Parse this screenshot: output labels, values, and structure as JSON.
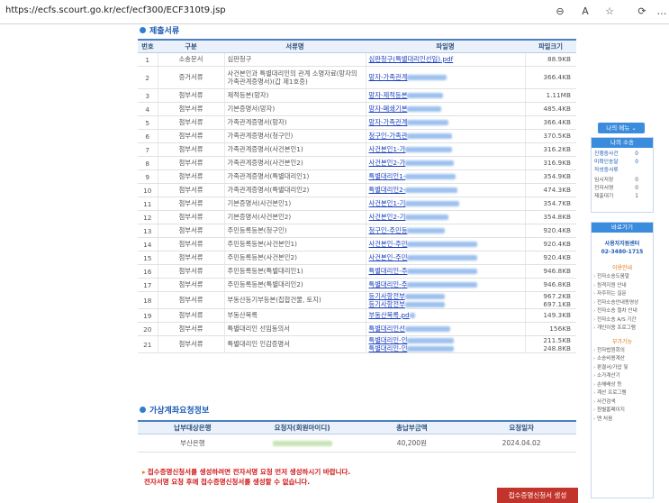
{
  "browser": {
    "url": "https://ecfs.scourt.go.kr/ecf/ecf300/ECF310t9.jsp",
    "icons": [
      "zoom-icon",
      "read-aloud-icon",
      "favorite-star-icon",
      "extensions-icon",
      "more-icon"
    ]
  },
  "submitted_docs": {
    "title": "제출서류",
    "columns": [
      "번호",
      "구분",
      "서류명",
      "파일명",
      "파일크기"
    ],
    "rows": [
      {
        "no": "1",
        "type": "소송문서",
        "name": "심판청구",
        "files": [
          "심판청구(특별대리인선임).pdf"
        ],
        "sizes": [
          "88.9KB"
        ]
      },
      {
        "no": "2",
        "type": "증거서류",
        "name": "사건본인과 특별대리인의 관계 소명자료(망자의 가족관계증명서)(갑 제1호증)",
        "files": [
          "망자-가족관계"
        ],
        "sizes": [
          "366.4KB"
        ]
      },
      {
        "no": "3",
        "type": "첨부서류",
        "name": "제적등본(망자)",
        "files": [
          "망자-제적등본"
        ],
        "sizes": [
          "1.11MB"
        ]
      },
      {
        "no": "4",
        "type": "첨부서류",
        "name": "기본증명서(망자)",
        "files": [
          "망자-폐쇄기본"
        ],
        "sizes": [
          "485.4KB"
        ]
      },
      {
        "no": "5",
        "type": "첨부서류",
        "name": "가족관계증명서(망자)",
        "files": [
          "망자-가족관계"
        ],
        "sizes": [
          "366.4KB"
        ]
      },
      {
        "no": "6",
        "type": "첨부서류",
        "name": "가족관계증명서(청구인)",
        "files": [
          "청구인-가족관"
        ],
        "sizes": [
          "370.5KB"
        ]
      },
      {
        "no": "7",
        "type": "첨부서류",
        "name": "가족관계증명서(사건본인1)",
        "files": [
          "사건본인1-가"
        ],
        "sizes": [
          "316.2KB"
        ]
      },
      {
        "no": "8",
        "type": "첨부서류",
        "name": "가족관계증명서(사건본인2)",
        "files": [
          "사건본인2-가"
        ],
        "sizes": [
          "316.9KB"
        ]
      },
      {
        "no": "9",
        "type": "첨부서류",
        "name": "가족관계증명서(특별대리인1)",
        "files": [
          "특별대리인1-"
        ],
        "sizes": [
          "354.9KB"
        ]
      },
      {
        "no": "10",
        "type": "첨부서류",
        "name": "가족관계증명서(특별대리인2)",
        "files": [
          "특별대리인2-"
        ],
        "sizes": [
          "474.3KB"
        ]
      },
      {
        "no": "11",
        "type": "첨부서류",
        "name": "기본증명서(사건본인1)",
        "files": [
          "사건본인1-기"
        ],
        "sizes": [
          "354.7KB"
        ]
      },
      {
        "no": "12",
        "type": "첨부서류",
        "name": "기본증명서(사건본인2)",
        "files": [
          "사건본인2-기"
        ],
        "sizes": [
          "354.8KB"
        ]
      },
      {
        "no": "13",
        "type": "첨부서류",
        "name": "주민등록등본(청구인)",
        "files": [
          "청구인-주민등"
        ],
        "sizes": [
          "920.4KB"
        ]
      },
      {
        "no": "14",
        "type": "첨부서류",
        "name": "주민등록등본(사건본인1)",
        "files": [
          "사건본인-주민"
        ],
        "sizes": [
          "920.4KB"
        ]
      },
      {
        "no": "15",
        "type": "첨부서류",
        "name": "주민등록등본(사건본인2)",
        "files": [
          "사건본인-주민"
        ],
        "sizes": [
          "920.4KB"
        ]
      },
      {
        "no": "16",
        "type": "첨부서류",
        "name": "주민등록등본(특별대리인1)",
        "files": [
          "특별대리인-주"
        ],
        "sizes": [
          "946.8KB"
        ]
      },
      {
        "no": "17",
        "type": "첨부서류",
        "name": "주민등록등본(특별대리인2)",
        "files": [
          "특별대리인-주"
        ],
        "sizes": [
          "946.8KB"
        ]
      },
      {
        "no": "18",
        "type": "첨부서류",
        "name": "부동산등기부등본(집합건물, 토지)",
        "files": [
          "등기사항전부",
          "등기사항전부"
        ],
        "sizes": [
          "967.2KB",
          "697.1KB"
        ]
      },
      {
        "no": "19",
        "type": "첨부서류",
        "name": "부동산목록",
        "files": [
          "부동산목록.pd"
        ],
        "sizes": [
          "149.3KB"
        ]
      },
      {
        "no": "20",
        "type": "첨부서류",
        "name": "특별대리인 선임동의서",
        "files": [
          "특별대리인선"
        ],
        "sizes": [
          "156KB"
        ]
      },
      {
        "no": "21",
        "type": "첨부서류",
        "name": "특별대리인 인감증명서",
        "files": [
          "특별대리인-인",
          "특별대리인-인"
        ],
        "sizes": [
          "211.5KB",
          "248.8KB"
        ]
      }
    ]
  },
  "virtual_account": {
    "title": "가상계좌요청정보",
    "columns": [
      "납부대상은행",
      "요청자(회원아이디)",
      "총납부금액",
      "요청일자"
    ],
    "row": {
      "bank": "부산은행",
      "requester": "",
      "amount": "40,200원",
      "date": "2024.04.02"
    }
  },
  "notice": {
    "line1": "접수증명신청서를 생성하려면 전자서명 요청 먼저 생성하시기 바랍니다.",
    "line2": "전자서명 요청 후에 접수증명신청서를 생성할 수 없습니다."
  },
  "action_button": "접수증명신청서 생성",
  "sidebar": {
    "menu_label": "나의 메뉴",
    "my_case": {
      "title": "나의 소송",
      "items": [
        {
          "label": "진행중사건",
          "value": "0"
        },
        {
          "label": "미확인송달",
          "value": "0"
        },
        {
          "label": "작성중서류",
          "value": ""
        },
        {
          "label": "임시저장",
          "value": "0"
        },
        {
          "label": "전자서명",
          "value": "0"
        },
        {
          "label": "제출대기",
          "value": "1"
        }
      ]
    },
    "shortcut": "바로가기",
    "help_center": "사용자지원센터",
    "phone": "02-3480-1715",
    "usage_title": "이용안내",
    "usage_links": [
      "전자소송도움말",
      "원격지원 안내",
      "자주하는 질문",
      "전자소송안내동영상",
      "전자소송 절차 안내",
      "전자소송 A/S 기간",
      "개인이용 프로그램"
    ],
    "extra_title": "부가기능",
    "extra_links": [
      "전자법원회의",
      "소송비용계산",
      "판결서/가압 및",
      "소가계산기",
      "손해배상 등",
      "계산 프로그램",
      "사건검색",
      "원별홈페이지",
      "맨 처음"
    ]
  }
}
